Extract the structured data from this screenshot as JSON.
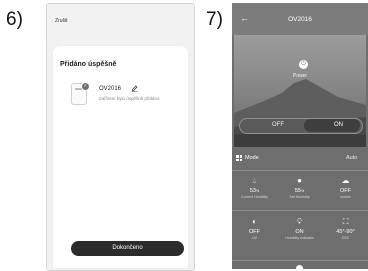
{
  "steps": [
    "6)",
    "7)"
  ],
  "screen1": {
    "back_label": "Zrušit",
    "title": "Přidáno úspěšně",
    "device_name": "OV2016",
    "device_status": "Zařízení bylo úspěšně přidáno",
    "done_button": "Dokončeno"
  },
  "screen2": {
    "back_arrow": "←",
    "title": "OV2016",
    "power_label": "Power",
    "toggle_off": "OFF",
    "toggle_on": "ON",
    "toggle_selected": "ON",
    "mode_label": "Mode",
    "mode_value": "Auto",
    "row1": [
      {
        "icon": "humidity-drop-icon",
        "value": "53%",
        "value_main": "53",
        "value_unit": "%",
        "label": "Current Humidity"
      },
      {
        "icon": "target-drop-icon",
        "value": "55%",
        "value_main": "55",
        "value_unit": "%",
        "label": "Set Humidity"
      },
      {
        "icon": "ionizer-leaf-icon",
        "value": "OFF",
        "label": "Ionizer"
      }
    ],
    "row2": [
      {
        "icon": "uv-icon",
        "value": "OFF",
        "label": "UV"
      },
      {
        "icon": "bulb-icon",
        "value": "ON",
        "label": "Humidity Indicator"
      },
      {
        "icon": "oscillation-icon",
        "value": "45°-90°",
        "label": "OSC"
      }
    ]
  }
}
